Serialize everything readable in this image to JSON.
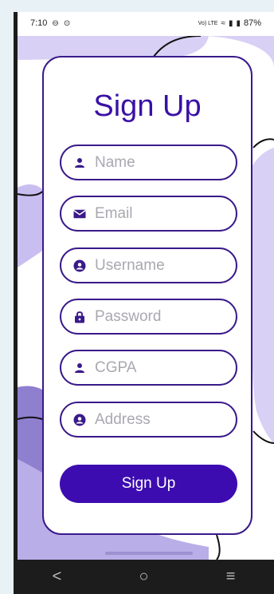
{
  "status": {
    "time": "7:10",
    "network": "Vo) LTE",
    "battery": "87%"
  },
  "title": "Sign Up",
  "fields": [
    {
      "placeholder": "Name",
      "icon": "person-icon"
    },
    {
      "placeholder": "Email",
      "icon": "email-icon"
    },
    {
      "placeholder": "Username",
      "icon": "account-circle-icon"
    },
    {
      "placeholder": "Password",
      "icon": "lock-icon"
    },
    {
      "placeholder": "CGPA",
      "icon": "person-icon"
    },
    {
      "placeholder": "Address",
      "icon": "account-circle-icon"
    }
  ],
  "button": {
    "label": "Sign Up"
  },
  "nav": {
    "back": "<",
    "home": "○",
    "recents": "≡"
  },
  "colors": {
    "accent": "#3c0cb0",
    "border": "#3a1a8a",
    "blob_light": "#d8d0f5",
    "blob_mid": "#b9aee8"
  }
}
